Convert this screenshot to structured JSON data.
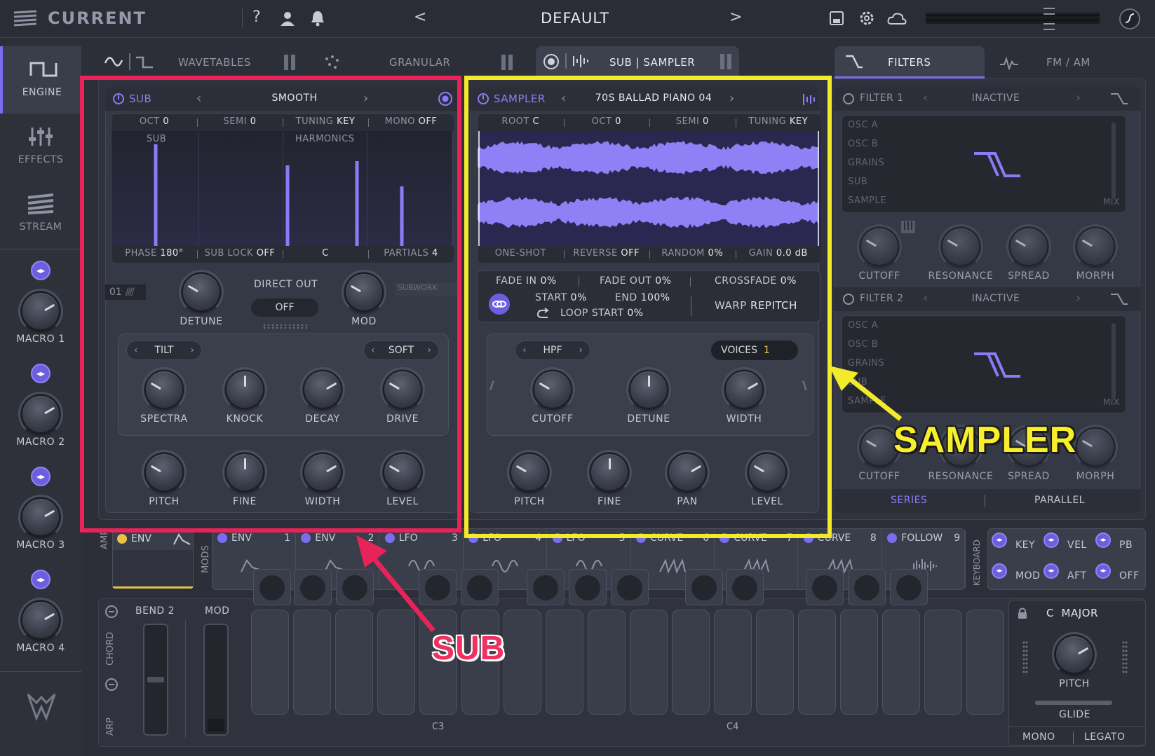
{
  "topbar": {
    "logo": "CURRENT",
    "help": "?",
    "preset_name": "DEFAULT",
    "prev": "<",
    "next": ">"
  },
  "sidebar": {
    "engine": "ENGINE",
    "effects": "EFFECTS",
    "stream": "STREAM",
    "macros": [
      "MACRO 1",
      "MACRO 2",
      "MACRO 3",
      "MACRO 4"
    ]
  },
  "tabs": {
    "wavetables": "WAVETABLES",
    "granular": "GRANULAR",
    "sub_sampler": "SUB | SAMPLER",
    "filters": "FILTERS",
    "fm_am": "FM / AM"
  },
  "sub": {
    "title": "SUB",
    "preset": "SMOOTH",
    "params": [
      {
        "k": "OCT",
        "v": "0"
      },
      {
        "k": "SEMI",
        "v": "0"
      },
      {
        "k": "TUNING",
        "v": "KEY"
      },
      {
        "k": "MONO",
        "v": "OFF"
      }
    ],
    "display_left": "SUB",
    "display_right": "HARMONICS",
    "bars": [
      0.98,
      0.78,
      0.82,
      0.58
    ],
    "footer": [
      {
        "k": "PHASE",
        "v": "180°"
      },
      {
        "k": "SUB LOCK",
        "v": "OFF"
      },
      {
        "k": "",
        "v": "C"
      },
      {
        "k": "PARTIALS",
        "v": "4"
      }
    ],
    "slot": "01",
    "subwork": "SUBWORK",
    "detune": "DETUNE",
    "direct_out": "DIRECT OUT",
    "direct_out_value": "OFF",
    "mod": "MOD",
    "tilt": "TILT",
    "soft": "SOFT",
    "row1": [
      "SPECTRA",
      "KNOCK",
      "DECAY",
      "DRIVE"
    ],
    "row2": [
      "PITCH",
      "FINE",
      "WIDTH",
      "LEVEL"
    ]
  },
  "sampler": {
    "title": "SAMPLER",
    "preset": "70S BALLAD PIANO 04",
    "params": [
      {
        "k": "ROOT",
        "v": "C"
      },
      {
        "k": "OCT",
        "v": "0"
      },
      {
        "k": "SEMI",
        "v": "0"
      },
      {
        "k": "TUNING",
        "v": "KEY"
      }
    ],
    "footer": [
      {
        "k": "ONE-SHOT",
        "v": ""
      },
      {
        "k": "REVERSE",
        "v": "OFF"
      },
      {
        "k": "RANDOM",
        "v": "0%"
      },
      {
        "k": "GAIN",
        "v": "0.0 dB"
      }
    ],
    "fade_in_label": "FADE IN",
    "fade_in": "0%",
    "fade_out_label": "FADE OUT",
    "fade_out": "0%",
    "crossfade_label": "CROSSFADE",
    "crossfade": "0%",
    "start_label": "START",
    "start": "0%",
    "end_label": "END",
    "end": "100%",
    "loop_start_label": "LOOP START",
    "loop_start": "0%",
    "warp_label": "WARP",
    "warp": "REPITCH",
    "hpf": "HPF",
    "voices_label": "VOICES",
    "voices": "1",
    "row1": [
      "CUTOFF",
      "DETUNE",
      "WIDTH"
    ],
    "row2": [
      "PITCH",
      "FINE",
      "PAN",
      "LEVEL"
    ]
  },
  "filters": {
    "f1_title": "FILTER 1",
    "f1_state": "INACTIVE",
    "f2_title": "FILTER 2",
    "f2_state": "INACTIVE",
    "routes": [
      "OSC A",
      "OSC B",
      "GRAINS",
      "SUB",
      "SAMPLE"
    ],
    "mix": "MIX",
    "knobs": [
      "CUTOFF",
      "RESONANCE",
      "SPREAD",
      "MORPH"
    ],
    "series": "SERIES",
    "parallel": "PARALLEL"
  },
  "annotations": {
    "sampler": "SAMPLER",
    "sub": "SUB"
  },
  "mods": {
    "amp": "AMP",
    "mods": "MODS",
    "amp_env": "ENV",
    "slots": [
      {
        "name": "ENV",
        "n": "1"
      },
      {
        "name": "ENV",
        "n": "2"
      },
      {
        "name": "LFO",
        "n": "3"
      },
      {
        "name": "LFO",
        "n": "4"
      },
      {
        "name": "LFO",
        "n": "5"
      },
      {
        "name": "CURVE",
        "n": "6"
      },
      {
        "name": "CURVE",
        "n": "7"
      },
      {
        "name": "CURVE",
        "n": "8"
      },
      {
        "name": "FOLLOW",
        "n": "9"
      }
    ],
    "keyboard": "KEYBOARD",
    "kb_sources": [
      "KEY",
      "VEL",
      "PB",
      "MOD",
      "AFT",
      "OFF"
    ]
  },
  "perf": {
    "bend_label": "BEND",
    "bend": "2",
    "mod_label": "MOD",
    "chord": "CHORD",
    "arp": "ARP",
    "c3": "C3",
    "c4": "C4",
    "scale": "C  MAJOR",
    "pitch": "PITCH",
    "glide": "GLIDE",
    "mono": "MONO",
    "legato": "LEGATO"
  }
}
